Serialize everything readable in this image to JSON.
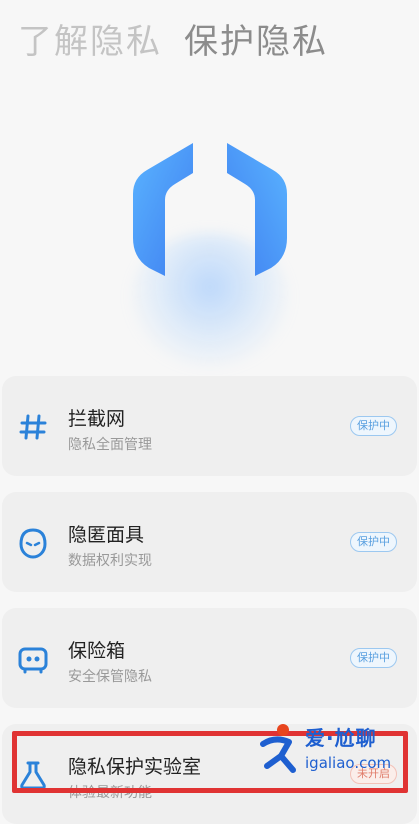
{
  "header": {
    "tab_learn": "了解隐私",
    "tab_protect": "保护隐私"
  },
  "cards": [
    {
      "icon": "hash-icon",
      "title": "拦截网",
      "subtitle": "隐私全面管理",
      "status": "保护中"
    },
    {
      "icon": "mask-face-icon",
      "title": "隐匿面具",
      "subtitle": "数据权利实现",
      "status": "保护中"
    },
    {
      "icon": "safe-box-icon",
      "title": "保险箱",
      "subtitle": "安全保管隐私",
      "status": "保护中"
    },
    {
      "icon": "flask-icon",
      "title": "隐私保护实验室",
      "subtitle": "体验最新功能",
      "status": "未开启"
    }
  ],
  "watermark": {
    "line1": "爱·尬聊",
    "line2": "igaliao.com"
  },
  "colors": {
    "accent_blue": "#4a9fff",
    "highlight_red": "#e03333",
    "badge_blue": "#5aa0e0",
    "badge_off": "#e07c6a"
  }
}
